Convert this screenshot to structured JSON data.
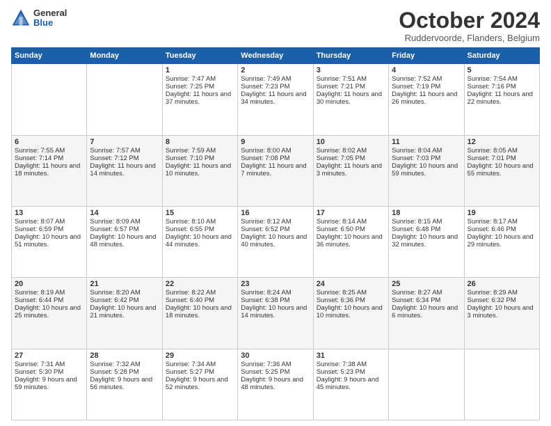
{
  "header": {
    "logo_general": "General",
    "logo_blue": "Blue",
    "month_title": "October 2024",
    "subtitle": "Ruddervoorde, Flanders, Belgium"
  },
  "weekdays": [
    "Sunday",
    "Monday",
    "Tuesday",
    "Wednesday",
    "Thursday",
    "Friday",
    "Saturday"
  ],
  "weeks": [
    [
      {
        "day": "",
        "sunrise": "",
        "sunset": "",
        "daylight": ""
      },
      {
        "day": "",
        "sunrise": "",
        "sunset": "",
        "daylight": ""
      },
      {
        "day": "1",
        "sunrise": "Sunrise: 7:47 AM",
        "sunset": "Sunset: 7:25 PM",
        "daylight": "Daylight: 11 hours and 37 minutes."
      },
      {
        "day": "2",
        "sunrise": "Sunrise: 7:49 AM",
        "sunset": "Sunset: 7:23 PM",
        "daylight": "Daylight: 11 hours and 34 minutes."
      },
      {
        "day": "3",
        "sunrise": "Sunrise: 7:51 AM",
        "sunset": "Sunset: 7:21 PM",
        "daylight": "Daylight: 11 hours and 30 minutes."
      },
      {
        "day": "4",
        "sunrise": "Sunrise: 7:52 AM",
        "sunset": "Sunset: 7:19 PM",
        "daylight": "Daylight: 11 hours and 26 minutes."
      },
      {
        "day": "5",
        "sunrise": "Sunrise: 7:54 AM",
        "sunset": "Sunset: 7:16 PM",
        "daylight": "Daylight: 11 hours and 22 minutes."
      }
    ],
    [
      {
        "day": "6",
        "sunrise": "Sunrise: 7:55 AM",
        "sunset": "Sunset: 7:14 PM",
        "daylight": "Daylight: 11 hours and 18 minutes."
      },
      {
        "day": "7",
        "sunrise": "Sunrise: 7:57 AM",
        "sunset": "Sunset: 7:12 PM",
        "daylight": "Daylight: 11 hours and 14 minutes."
      },
      {
        "day": "8",
        "sunrise": "Sunrise: 7:59 AM",
        "sunset": "Sunset: 7:10 PM",
        "daylight": "Daylight: 11 hours and 10 minutes."
      },
      {
        "day": "9",
        "sunrise": "Sunrise: 8:00 AM",
        "sunset": "Sunset: 7:08 PM",
        "daylight": "Daylight: 11 hours and 7 minutes."
      },
      {
        "day": "10",
        "sunrise": "Sunrise: 8:02 AM",
        "sunset": "Sunset: 7:05 PM",
        "daylight": "Daylight: 11 hours and 3 minutes."
      },
      {
        "day": "11",
        "sunrise": "Sunrise: 8:04 AM",
        "sunset": "Sunset: 7:03 PM",
        "daylight": "Daylight: 10 hours and 59 minutes."
      },
      {
        "day": "12",
        "sunrise": "Sunrise: 8:05 AM",
        "sunset": "Sunset: 7:01 PM",
        "daylight": "Daylight: 10 hours and 55 minutes."
      }
    ],
    [
      {
        "day": "13",
        "sunrise": "Sunrise: 8:07 AM",
        "sunset": "Sunset: 6:59 PM",
        "daylight": "Daylight: 10 hours and 51 minutes."
      },
      {
        "day": "14",
        "sunrise": "Sunrise: 8:09 AM",
        "sunset": "Sunset: 6:57 PM",
        "daylight": "Daylight: 10 hours and 48 minutes."
      },
      {
        "day": "15",
        "sunrise": "Sunrise: 8:10 AM",
        "sunset": "Sunset: 6:55 PM",
        "daylight": "Daylight: 10 hours and 44 minutes."
      },
      {
        "day": "16",
        "sunrise": "Sunrise: 8:12 AM",
        "sunset": "Sunset: 6:52 PM",
        "daylight": "Daylight: 10 hours and 40 minutes."
      },
      {
        "day": "17",
        "sunrise": "Sunrise: 8:14 AM",
        "sunset": "Sunset: 6:50 PM",
        "daylight": "Daylight: 10 hours and 36 minutes."
      },
      {
        "day": "18",
        "sunrise": "Sunrise: 8:15 AM",
        "sunset": "Sunset: 6:48 PM",
        "daylight": "Daylight: 10 hours and 32 minutes."
      },
      {
        "day": "19",
        "sunrise": "Sunrise: 8:17 AM",
        "sunset": "Sunset: 6:46 PM",
        "daylight": "Daylight: 10 hours and 29 minutes."
      }
    ],
    [
      {
        "day": "20",
        "sunrise": "Sunrise: 8:19 AM",
        "sunset": "Sunset: 6:44 PM",
        "daylight": "Daylight: 10 hours and 25 minutes."
      },
      {
        "day": "21",
        "sunrise": "Sunrise: 8:20 AM",
        "sunset": "Sunset: 6:42 PM",
        "daylight": "Daylight: 10 hours and 21 minutes."
      },
      {
        "day": "22",
        "sunrise": "Sunrise: 8:22 AM",
        "sunset": "Sunset: 6:40 PM",
        "daylight": "Daylight: 10 hours and 18 minutes."
      },
      {
        "day": "23",
        "sunrise": "Sunrise: 8:24 AM",
        "sunset": "Sunset: 6:38 PM",
        "daylight": "Daylight: 10 hours and 14 minutes."
      },
      {
        "day": "24",
        "sunrise": "Sunrise: 8:25 AM",
        "sunset": "Sunset: 6:36 PM",
        "daylight": "Daylight: 10 hours and 10 minutes."
      },
      {
        "day": "25",
        "sunrise": "Sunrise: 8:27 AM",
        "sunset": "Sunset: 6:34 PM",
        "daylight": "Daylight: 10 hours and 6 minutes."
      },
      {
        "day": "26",
        "sunrise": "Sunrise: 8:29 AM",
        "sunset": "Sunset: 6:32 PM",
        "daylight": "Daylight: 10 hours and 3 minutes."
      }
    ],
    [
      {
        "day": "27",
        "sunrise": "Sunrise: 7:31 AM",
        "sunset": "Sunset: 5:30 PM",
        "daylight": "Daylight: 9 hours and 59 minutes."
      },
      {
        "day": "28",
        "sunrise": "Sunrise: 7:32 AM",
        "sunset": "Sunset: 5:28 PM",
        "daylight": "Daylight: 9 hours and 56 minutes."
      },
      {
        "day": "29",
        "sunrise": "Sunrise: 7:34 AM",
        "sunset": "Sunset: 5:27 PM",
        "daylight": "Daylight: 9 hours and 52 minutes."
      },
      {
        "day": "30",
        "sunrise": "Sunrise: 7:36 AM",
        "sunset": "Sunset: 5:25 PM",
        "daylight": "Daylight: 9 hours and 48 minutes."
      },
      {
        "day": "31",
        "sunrise": "Sunrise: 7:38 AM",
        "sunset": "Sunset: 5:23 PM",
        "daylight": "Daylight: 9 hours and 45 minutes."
      },
      {
        "day": "",
        "sunrise": "",
        "sunset": "",
        "daylight": ""
      },
      {
        "day": "",
        "sunrise": "",
        "sunset": "",
        "daylight": ""
      }
    ]
  ]
}
